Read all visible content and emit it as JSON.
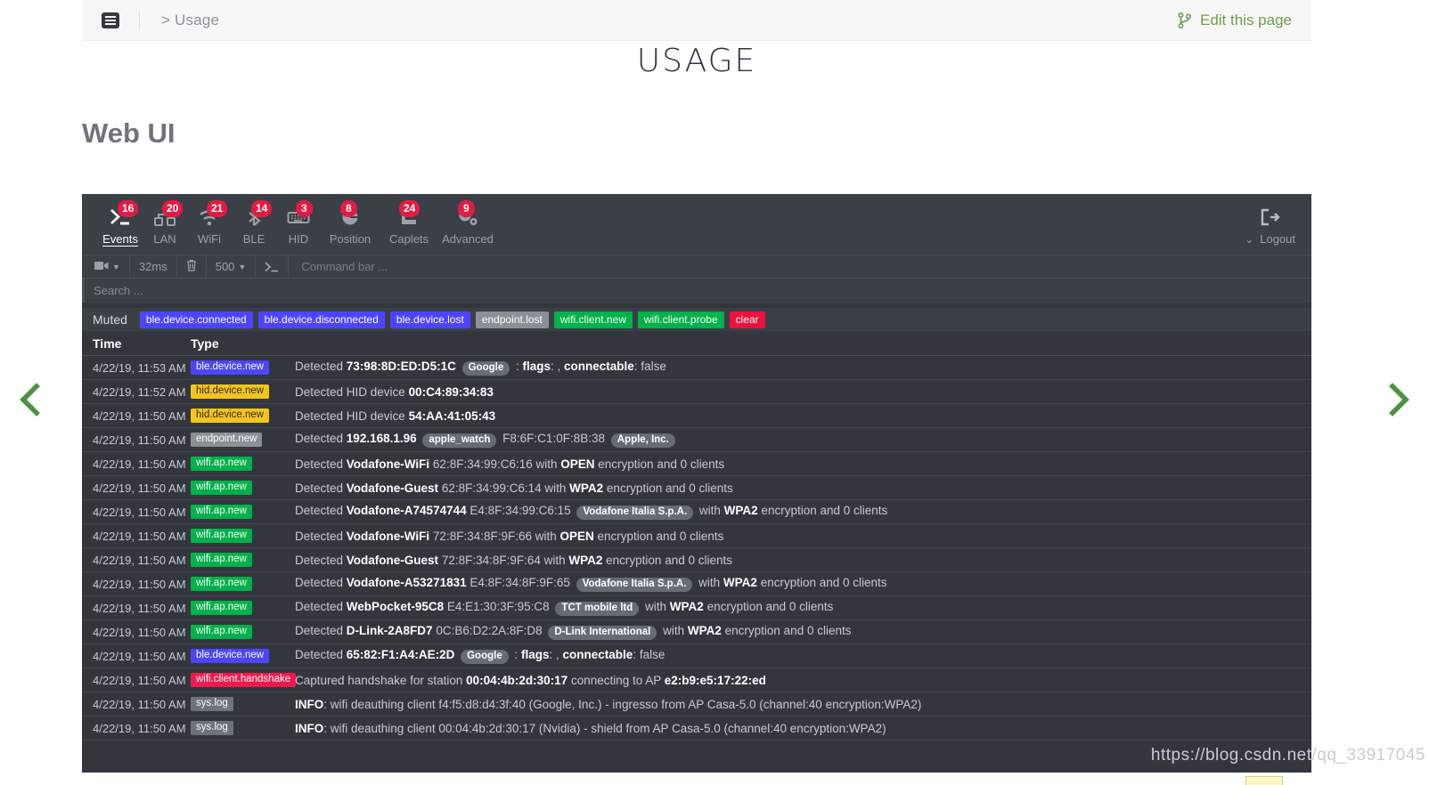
{
  "docbar": {
    "menu_icon": "list-menu-icon",
    "breadcrumb": "> Usage",
    "edit_label": "Edit this page",
    "edit_icon": "git-branch-icon",
    "accent_green": "#6a9e4e"
  },
  "page": {
    "title": "USAGE",
    "section_title": "Web UI"
  },
  "nav": {
    "items": [
      {
        "label": "Events",
        "badge": "16",
        "icon": "terminal-prompt-icon",
        "active": true
      },
      {
        "label": "LAN",
        "badge": "20",
        "icon": "network-nodes-icon",
        "active": false
      },
      {
        "label": "WiFi",
        "badge": "21",
        "icon": "wifi-icon",
        "active": false
      },
      {
        "label": "BLE",
        "badge": "14",
        "icon": "bluetooth-icon",
        "active": false
      },
      {
        "label": "HID",
        "badge": "3",
        "icon": "keyboard-icon",
        "active": false
      },
      {
        "label": "Position",
        "badge": "8",
        "icon": "globe-pin-icon",
        "active": false
      },
      {
        "label": "Caplets",
        "badge": "24",
        "icon": "script-flag-icon",
        "active": false
      },
      {
        "label": "Advanced",
        "badge": "9",
        "icon": "gears-icon",
        "active": false
      }
    ],
    "logout": {
      "label": "Logout",
      "icon": "sign-out-icon",
      "chevron": "chevron-double-down-icon"
    },
    "badge_color": "#e31b42"
  },
  "toolbar": {
    "record_icon": "video-camera-icon",
    "record_caret": "caret-down-icon",
    "interval": "32ms",
    "clear_icon": "trash-icon",
    "rows": "500",
    "rows_caret": "caret-down-icon",
    "prompt_icon": "terminal-prompt-icon",
    "command_placeholder": "Command bar ..."
  },
  "search": {
    "placeholder": "Search ..."
  },
  "muted": {
    "label": "Muted",
    "tags": [
      {
        "text": "ble.device.connected",
        "style": "ble"
      },
      {
        "text": "ble.device.disconnected",
        "style": "ble"
      },
      {
        "text": "ble.device.lost",
        "style": "ble"
      },
      {
        "text": "endpoint.lost",
        "style": "gray"
      },
      {
        "text": "wifi.client.new",
        "style": "green"
      },
      {
        "text": "wifi.client.probe",
        "style": "green"
      },
      {
        "text": "clear",
        "style": "red"
      }
    ]
  },
  "table": {
    "headers": {
      "time": "Time",
      "type": "Type"
    },
    "rows": [
      {
        "time": "4/22/19, 11:53 AM",
        "type": "ble.device.new",
        "tag_style": "blue",
        "desc_html": "Detected <b>73:98:8D:ED:D5:1C</b> <span class=\"pill\">Google</span> : <b>flags</b>: , <b>connectable</b>: false"
      },
      {
        "time": "4/22/19, 11:52 AM",
        "type": "hid.device.new",
        "tag_style": "yellow",
        "desc_html": "Detected HID device <b>00:C4:89:34:83</b>"
      },
      {
        "time": "4/22/19, 11:50 AM",
        "type": "hid.device.new",
        "tag_style": "yellow",
        "desc_html": "Detected HID device <b>54:AA:41:05:43</b>"
      },
      {
        "time": "4/22/19, 11:50 AM",
        "type": "endpoint.new",
        "tag_style": "gray",
        "desc_html": "Detected <b>192.168.1.96</b> <span class=\"pill\">apple_watch</span> F8:6F:C1:0F:8B:38 <span class=\"pill\">Apple, Inc.</span>"
      },
      {
        "time": "4/22/19, 11:50 AM",
        "type": "wifi.ap.new",
        "tag_style": "green",
        "desc_html": "Detected <b>Vodafone-WiFi</b> 62:8F:34:99:C6:16 with <b>OPEN</b> encryption and 0 clients"
      },
      {
        "time": "4/22/19, 11:50 AM",
        "type": "wifi.ap.new",
        "tag_style": "green",
        "desc_html": "Detected <b>Vodafone-Guest</b> 62:8F:34:99:C6:14 with <b>WPA2</b> encryption and 0 clients"
      },
      {
        "time": "4/22/19, 11:50 AM",
        "type": "wifi.ap.new",
        "tag_style": "green",
        "desc_html": "Detected <b>Vodafone-A74574744</b> E4:8F:34:99:C6:15 <span class=\"pill\">Vodafone Italia S.p.A.</span> with <b>WPA2</b> encryption and 0 clients"
      },
      {
        "time": "4/22/19, 11:50 AM",
        "type": "wifi.ap.new",
        "tag_style": "green",
        "desc_html": "Detected <b>Vodafone-WiFi</b> 72:8F:34:8F:9F:66 with <b>OPEN</b> encryption and 0 clients"
      },
      {
        "time": "4/22/19, 11:50 AM",
        "type": "wifi.ap.new",
        "tag_style": "green",
        "desc_html": "Detected <b>Vodafone-Guest</b> 72:8F:34:8F:9F:64 with <b>WPA2</b> encryption and 0 clients"
      },
      {
        "time": "4/22/19, 11:50 AM",
        "type": "wifi.ap.new",
        "tag_style": "green",
        "desc_html": "Detected <b>Vodafone-A53271831</b> E4:8F:34:8F:9F:65 <span class=\"pill\">Vodafone Italia S.p.A.</span> with <b>WPA2</b> encryption and 0 clients"
      },
      {
        "time": "4/22/19, 11:50 AM",
        "type": "wifi.ap.new",
        "tag_style": "green",
        "desc_html": "Detected <b>WebPocket-95C8</b> E4:E1:30:3F:95:C8 <span class=\"pill\">TCT mobile ltd</span> with <b>WPA2</b> encryption and 0 clients"
      },
      {
        "time": "4/22/19, 11:50 AM",
        "type": "wifi.ap.new",
        "tag_style": "green",
        "desc_html": "Detected <b>D-Link-2A8FD7</b> 0C:B6:D2:2A:8F:D8 <span class=\"pill\">D-Link International</span> with <b>WPA2</b> encryption and 0 clients"
      },
      {
        "time": "4/22/19, 11:50 AM",
        "type": "ble.device.new",
        "tag_style": "blue",
        "desc_html": "Detected <b>65:82:F1:A4:AE:2D</b> <span class=\"pill\">Google</span> : <b>flags</b>: , <b>connectable</b>: false"
      },
      {
        "time": "4/22/19, 11:50 AM",
        "type": "wifi.client.handshake",
        "tag_style": "pink",
        "desc_html": "Captured handshake for station <b>00:04:4b:2d:30:17</b> connecting to AP <b>e2:b9:e5:17:22:ed</b>"
      },
      {
        "time": "4/22/19, 11:50 AM",
        "type": "sys.log",
        "tag_style": "syslog",
        "desc_html": "<b>INFO</b>: wifi deauthing client f4:f5:d8:d4:3f:40 (Google, Inc.) - ingresso from AP Casa-5.0 (channel:40 encryption:WPA2)"
      },
      {
        "time": "4/22/19, 11:50 AM",
        "type": "sys.log",
        "tag_style": "syslog",
        "desc_html": "<b>INFO</b>: wifi deauthing client 00:04:4b:2d:30:17 (Nvidia) - shield from AP Casa-5.0 (channel:40 encryption:WPA2)"
      }
    ]
  },
  "carousel": {
    "prev_icon": "chevron-left-icon",
    "next_icon": "chevron-right-icon",
    "arrow_color": "#4e9240"
  },
  "watermark": {
    "text": "https://blog.csdn.net/qq_33917045"
  }
}
